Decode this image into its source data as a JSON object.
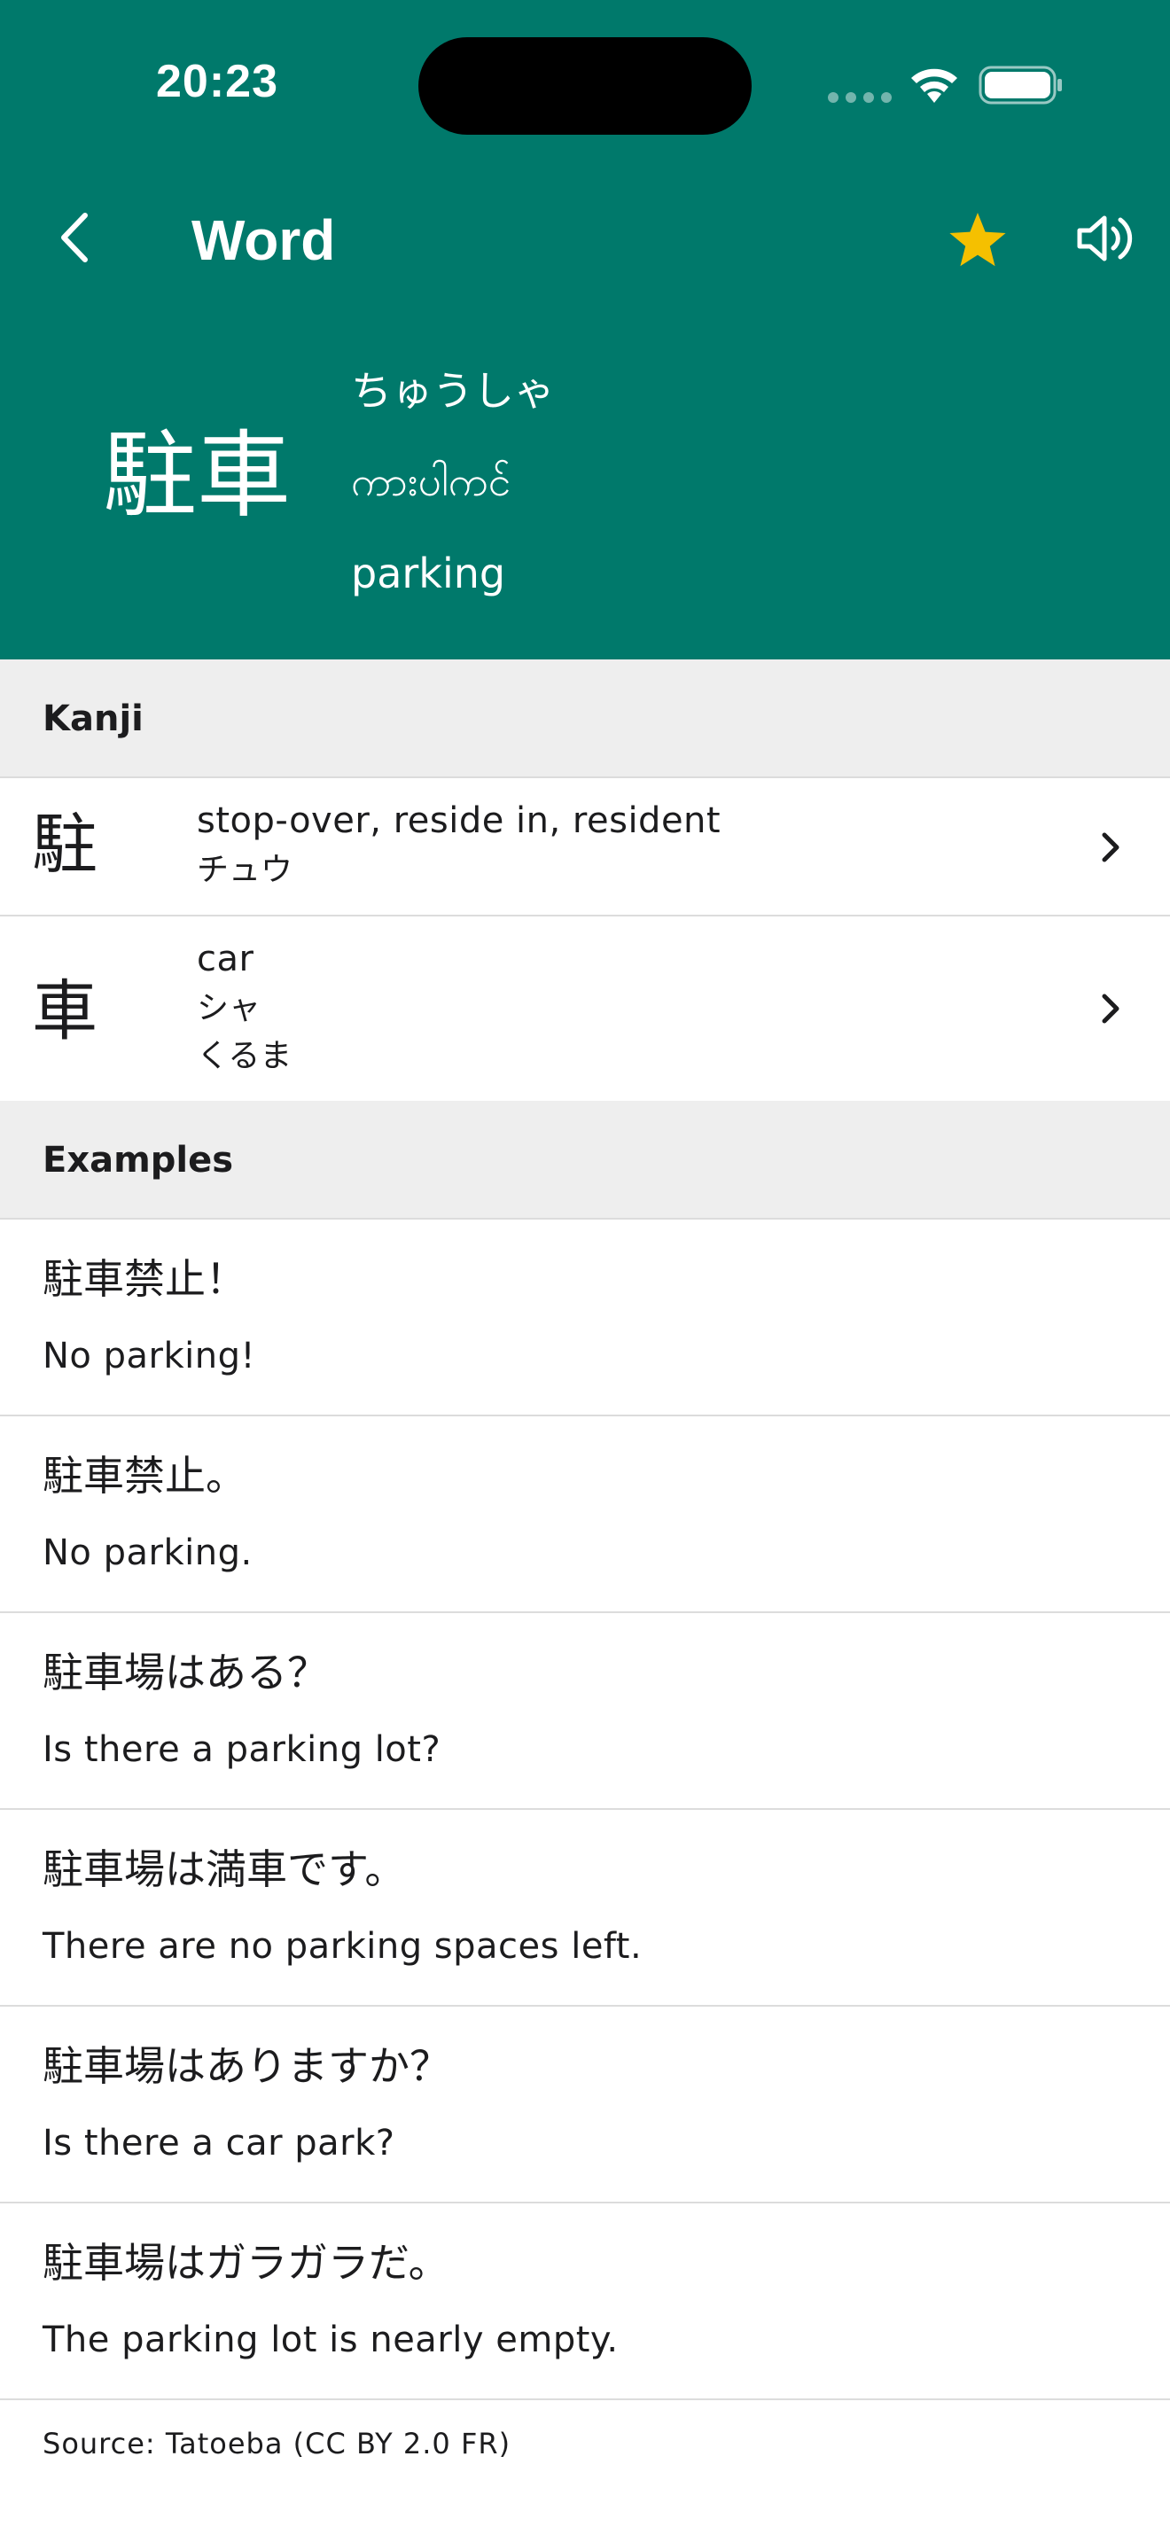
{
  "status_bar": {
    "time": "20:23"
  },
  "nav": {
    "title": "Word",
    "back_icon": "chevron-left-icon",
    "favorite_icon": "star-icon",
    "audio_icon": "speaker-icon",
    "favorite_color": "#f5c000"
  },
  "word": {
    "kanji": "駐車",
    "reading": "ちゅうしゃ",
    "burmese": "ကားပါကင်",
    "meaning": "parking"
  },
  "theme": {
    "header_bg": "#00796b",
    "section_bg": "#eeeeee"
  },
  "kanji_section": {
    "title": "Kanji",
    "items": [
      {
        "char": "駐",
        "meaning": "stop-over, reside in, resident",
        "readings": [
          "チュウ"
        ]
      },
      {
        "char": "車",
        "meaning": "car",
        "readings": [
          "シャ",
          "くるま"
        ]
      }
    ]
  },
  "examples_section": {
    "title": "Examples",
    "items": [
      {
        "jp": "駐車禁止！",
        "en": "No parking!"
      },
      {
        "jp": "駐車禁止。",
        "en": "No parking."
      },
      {
        "jp": "駐車場はある？",
        "en": "Is there a parking lot?"
      },
      {
        "jp": "駐車場は満車です。",
        "en": "There are no parking spaces left."
      },
      {
        "jp": "駐車場はありますか？",
        "en": "Is there a car park?"
      },
      {
        "jp": "駐車場はガラガラだ。",
        "en": "The parking lot is nearly empty."
      }
    ],
    "source": "Source: Tatoeba (CC BY 2.0 FR)"
  }
}
